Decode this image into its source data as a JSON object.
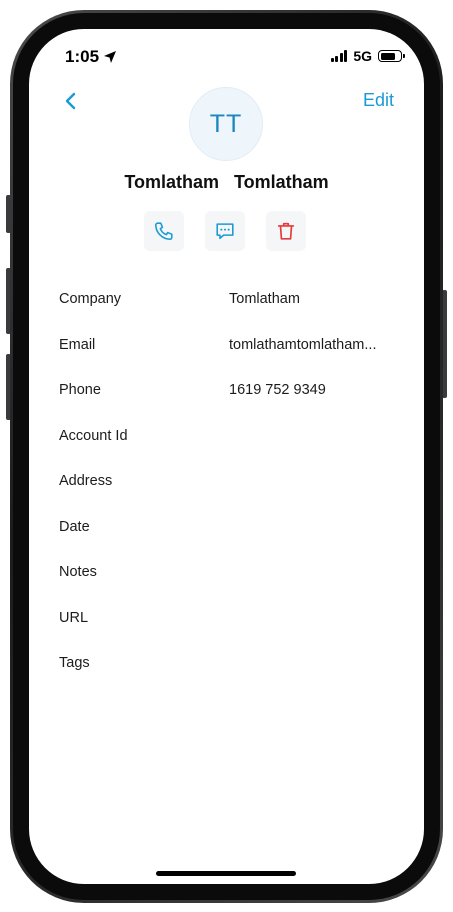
{
  "status_bar": {
    "time": "1:05",
    "network": "5G"
  },
  "nav": {
    "edit_label": "Edit"
  },
  "contact": {
    "initials": "TT",
    "name": "Tomlatham   Tomlatham"
  },
  "fields": [
    {
      "label": "Company",
      "value": "Tomlatham"
    },
    {
      "label": "Email",
      "value": "tomlathamtomlatham..."
    },
    {
      "label": "Phone",
      "value": "1619 752 9349"
    },
    {
      "label": "Account Id",
      "value": ""
    },
    {
      "label": "Address",
      "value": ""
    },
    {
      "label": "Date",
      "value": ""
    },
    {
      "label": "Notes",
      "value": ""
    },
    {
      "label": "URL",
      "value": ""
    },
    {
      "label": "Tags",
      "value": ""
    }
  ],
  "colors": {
    "accent": "#1a9ad6",
    "delete": "#e5393a"
  },
  "icons": [
    "location-arrow-icon",
    "signal-icon",
    "battery-icon",
    "chevron-left-icon",
    "phone-icon",
    "message-icon",
    "trash-icon"
  ]
}
